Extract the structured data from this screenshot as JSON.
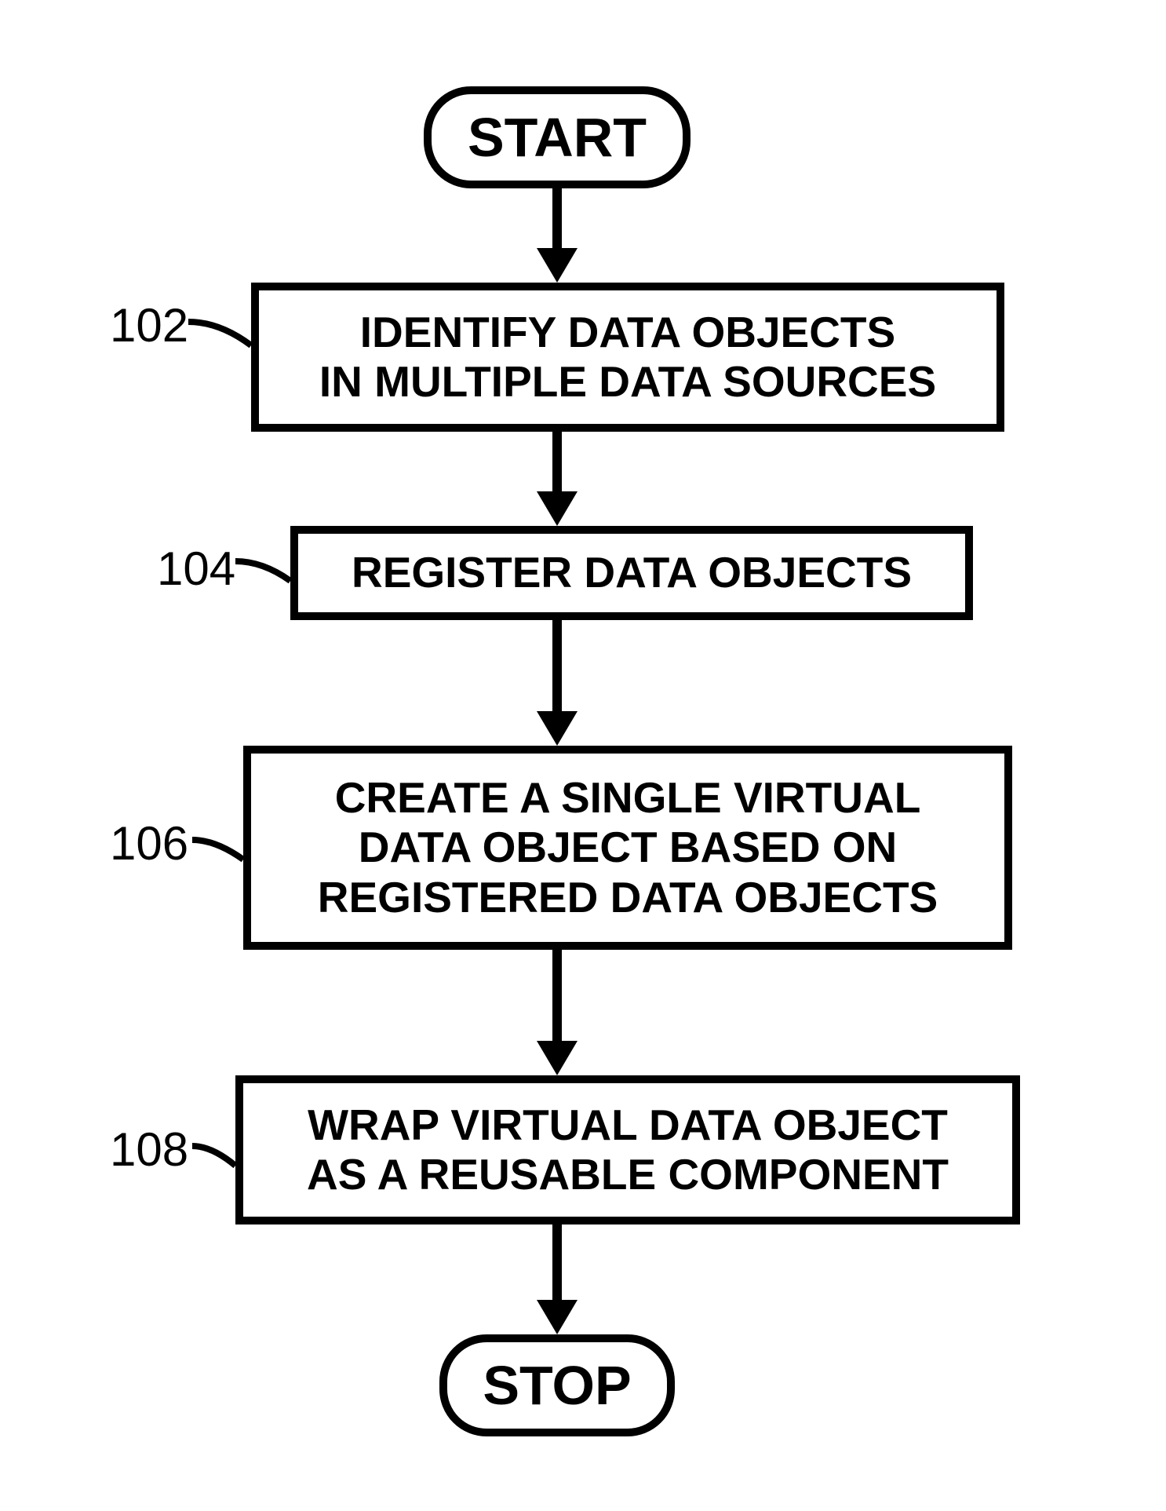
{
  "flow": {
    "start": "START",
    "stop": "STOP",
    "steps": {
      "s102": {
        "ref": "102",
        "text": "IDENTIFY DATA OBJECTS\nIN MULTIPLE DATA SOURCES"
      },
      "s104": {
        "ref": "104",
        "text": "REGISTER DATA OBJECTS"
      },
      "s106": {
        "ref": "106",
        "text": "CREATE A SINGLE VIRTUAL\nDATA OBJECT BASED ON\nREGISTERED DATA OBJECTS"
      },
      "s108": {
        "ref": "108",
        "text": "WRAP VIRTUAL DATA OBJECT\nAS A REUSABLE COMPONENT"
      }
    }
  }
}
